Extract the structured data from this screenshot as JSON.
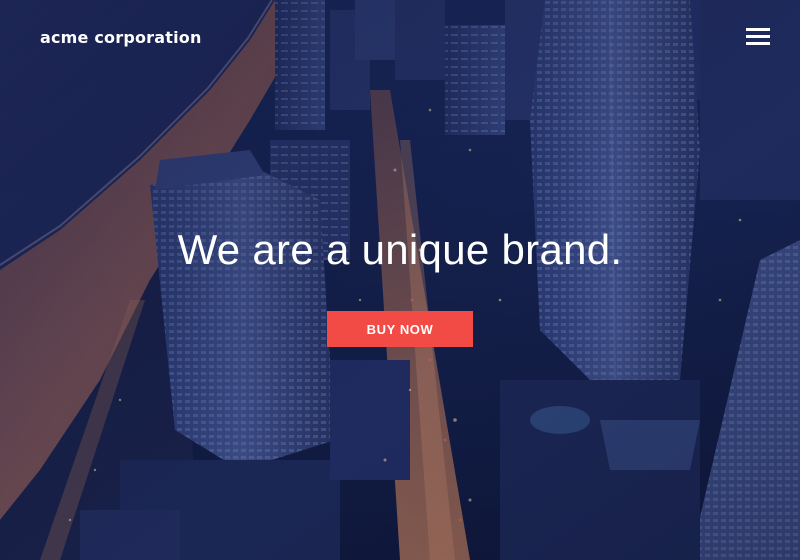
{
  "header": {
    "brand": "acme corporation",
    "menu_icon": "hamburger-menu-icon"
  },
  "hero": {
    "background": "aerial-night-city-skyline-photo",
    "headline": "We are a unique brand.",
    "cta_label": "BUY NOW"
  },
  "colors": {
    "cta_background": "#f24b45",
    "text": "#ffffff",
    "overlay": "#0d1a4d"
  }
}
